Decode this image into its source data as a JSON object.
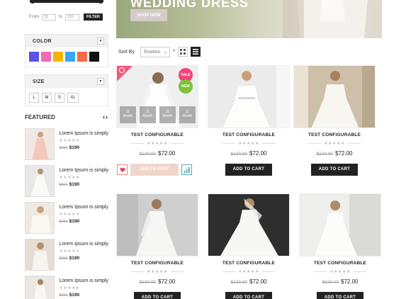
{
  "sidebar": {
    "price": {
      "from_label": "From",
      "from_value": "33",
      "to_label": "to",
      "to_value": "220",
      "filter_button": "FILTER"
    },
    "color": {
      "title": "COLOR",
      "toggle": "▼",
      "swatches": [
        "#5b52e8",
        "#f16bb5",
        "#f4b400",
        "#3aa6f0",
        "#f06b4a",
        "#111111"
      ]
    },
    "size": {
      "title": "SIZE",
      "toggle": "▼",
      "options": [
        "L",
        "M",
        "S",
        "XL"
      ]
    },
    "featured": {
      "title": "FEATURED",
      "arrows": "‹›",
      "items": [
        {
          "name": "Lorem Ipsum is simply",
          "stars": "★★★★★",
          "old_price": "$201",
          "price": "$190"
        },
        {
          "name": "Lorem Ipsum is simply",
          "stars": "★★★★★",
          "old_price": "$201",
          "price": "$190"
        },
        {
          "name": "Lorem Ipsum is simply",
          "stars": "★★★★★",
          "old_price": "$201",
          "price": "$190"
        },
        {
          "name": "Lorem Ipsum is simply",
          "stars": "★★★★★",
          "old_price": "$201",
          "price": "$190"
        },
        {
          "name": "Lorem Ipsum is simply",
          "stars": "★★★★★",
          "old_price": "$201",
          "price": "$190"
        }
      ]
    }
  },
  "banner": {
    "title": "WEDDING DRESS",
    "button": "SHOP NOW"
  },
  "toolbar": {
    "sort_label": "Sort By",
    "sort_value": "Position",
    "sort_caret": "⌄",
    "sort_direction": "^"
  },
  "products": [
    {
      "name": "TEST CONFIGURABLE",
      "stars": "★★★★★",
      "old_price": "$120.00",
      "price": "$72.00",
      "cart": "ADD TO CART",
      "badges": {
        "sale": "SALE",
        "new": "NEW"
      },
      "countdown": [
        {
          "value": "11",
          "unit": "Month"
        },
        {
          "value": "11",
          "unit": "Month"
        },
        {
          "value": "11",
          "unit": "Month"
        },
        {
          "value": "11",
          "unit": "Month"
        }
      ]
    },
    {
      "name": "TEST CONFIGURABLE",
      "stars": "★★★★★",
      "old_price": "$120.00",
      "price": "$72.00",
      "cart": "ADD TO CART"
    },
    {
      "name": "TEST CONFIGURABLE",
      "stars": "★★★★★",
      "old_price": "$120.00",
      "price": "$72.00",
      "cart": "ADD TO CART"
    },
    {
      "name": "TEST CONFIGURABLE",
      "stars": "★★★★★",
      "old_price": "$120.00",
      "price": "$72.00",
      "cart": "ADD TO CART"
    },
    {
      "name": "TEST CONFIGURABLE",
      "stars": "★★★★★",
      "old_price": "$120.00",
      "price": "$72.00",
      "cart": "ADD TO CART"
    },
    {
      "name": "TEST CONFIGURABLE",
      "stars": "★★★★★",
      "old_price": "$120.00",
      "price": "$72.00",
      "cart": "ADD TO CART"
    }
  ]
}
